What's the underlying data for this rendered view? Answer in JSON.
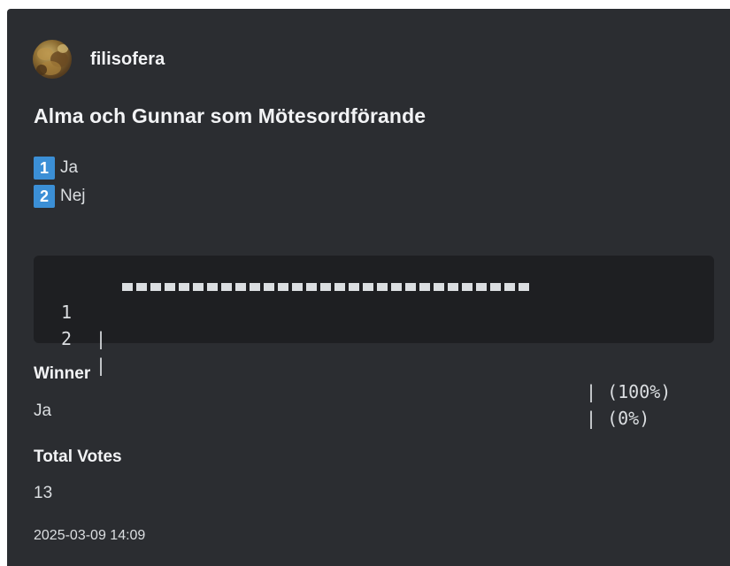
{
  "author": {
    "name": "filisofera",
    "avatar_icon": "user-avatar"
  },
  "poll": {
    "title": "Alma och Gunnar som Mötesordförande",
    "options": [
      {
        "number": "1",
        "label": "Ja"
      },
      {
        "number": "2",
        "label": "Nej"
      }
    ],
    "results": [
      {
        "number": "1",
        "pipe": "|",
        "bar_segments": 29,
        "share": 1.0,
        "percent_text": "| (100%)"
      },
      {
        "number": "2",
        "pipe": "|",
        "bar_segments": 0,
        "share": 0.0,
        "percent_text": "| (0%)"
      }
    ]
  },
  "fields": {
    "winner_label": "Winner",
    "winner_value": "Ja",
    "total_votes_label": "Total Votes",
    "total_votes_value": "13"
  },
  "footer": {
    "timestamp": "2025-03-09 14:09"
  },
  "colors": {
    "embed_background": "#2b2d31",
    "code_background": "#1e1f22",
    "option_badge": "#3b8fd6",
    "text": "#dbdee1",
    "heading_text": "#f2f3f5"
  }
}
